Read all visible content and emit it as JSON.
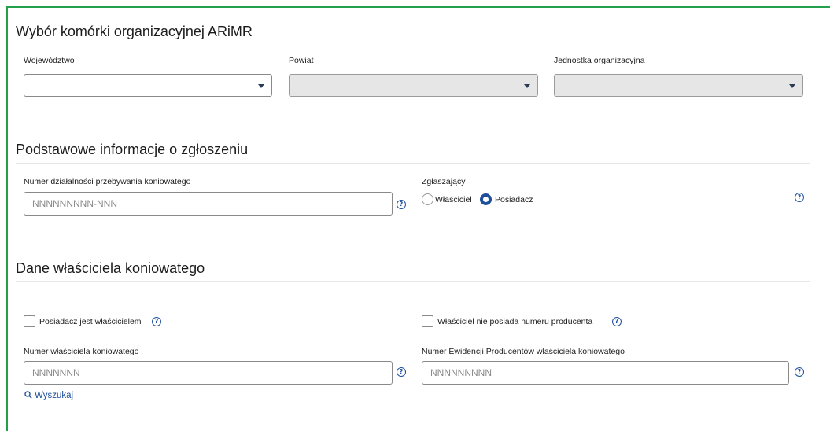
{
  "sections": {
    "unit": {
      "title": "Wybór komórki organizacyjnej ARiMR"
    },
    "basic": {
      "title": "Podstawowe informacje o zgłoszeniu"
    },
    "owner": {
      "title": "Dane właściciela koniowatego"
    }
  },
  "fields": {
    "wojewodztwo": {
      "label": "Województwo",
      "value": ""
    },
    "powiat": {
      "label": "Powiat",
      "value": ""
    },
    "jednostka": {
      "label": "Jednostka organizacyjna",
      "value": ""
    },
    "numer_dzialalnosci": {
      "label": "Numer działalności przebywania koniowatego",
      "placeholder": "NNNNNNNNN-NNN"
    },
    "zglaszajacy": {
      "label": "Zgłaszający",
      "options": [
        "Właściciel",
        "Posiadacz"
      ],
      "selected": "Posiadacz"
    },
    "posiadacz_wlasciciel": {
      "label": "Posiadacz jest właścicielem",
      "checked": false
    },
    "brak_numeru_producenta": {
      "label": "Właściciel nie posiada numeru producenta",
      "checked": false
    },
    "numer_wlasciciela": {
      "label": "Numer właściciela koniowatego",
      "placeholder": "NNNNNNN"
    },
    "numer_ewidencji": {
      "label": "Numer Ewidencji Producentów właściciela koniowatego",
      "placeholder": "NNNNNNNNN"
    }
  },
  "links": {
    "search": "Wyszukaj"
  },
  "icons": {
    "help": "help-circle-icon",
    "caret": "caret-down-icon",
    "search": "search-icon"
  },
  "colors": {
    "accent": "#1f4f9c",
    "frame": "#22a04a",
    "disabled": "#e6e6e6"
  }
}
